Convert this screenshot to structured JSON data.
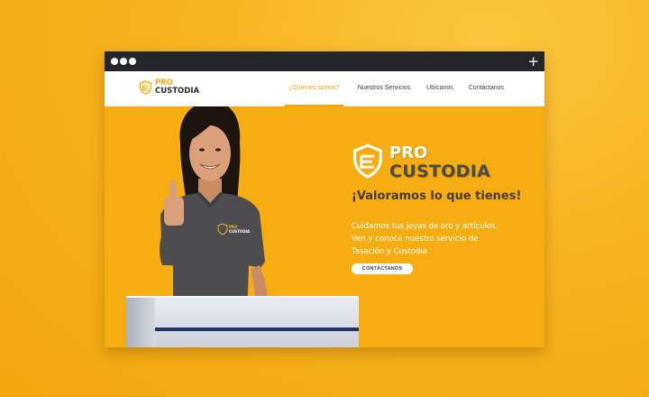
{
  "brand": {
    "line1": "PRO",
    "line2": "CUSTODIA",
    "primary_color": "#f6ad12",
    "dark_color": "#4a4a4a"
  },
  "window": {
    "controls": [
      "dot",
      "dot",
      "dot"
    ],
    "new_tab_label": "+"
  },
  "nav": {
    "items": [
      {
        "label": "¿Quiénes somos?",
        "active": true
      },
      {
        "label": "Nuestros Servicios",
        "active": false
      },
      {
        "label": "Ubícanos",
        "active": false
      },
      {
        "label": "Contáctanos",
        "active": false
      }
    ]
  },
  "hero": {
    "slogan": "¡Valoramos lo que tienes!",
    "description_lines": [
      "Cuidamos tus joyas de oro y artículos.",
      "Ven y conoce nuestro servicio de",
      "Tasación y Custodia"
    ],
    "cta_label": "CONTÁCTANOS",
    "shirt_logo_line1": "PRO",
    "shirt_logo_line2": "CUSTODIA"
  }
}
